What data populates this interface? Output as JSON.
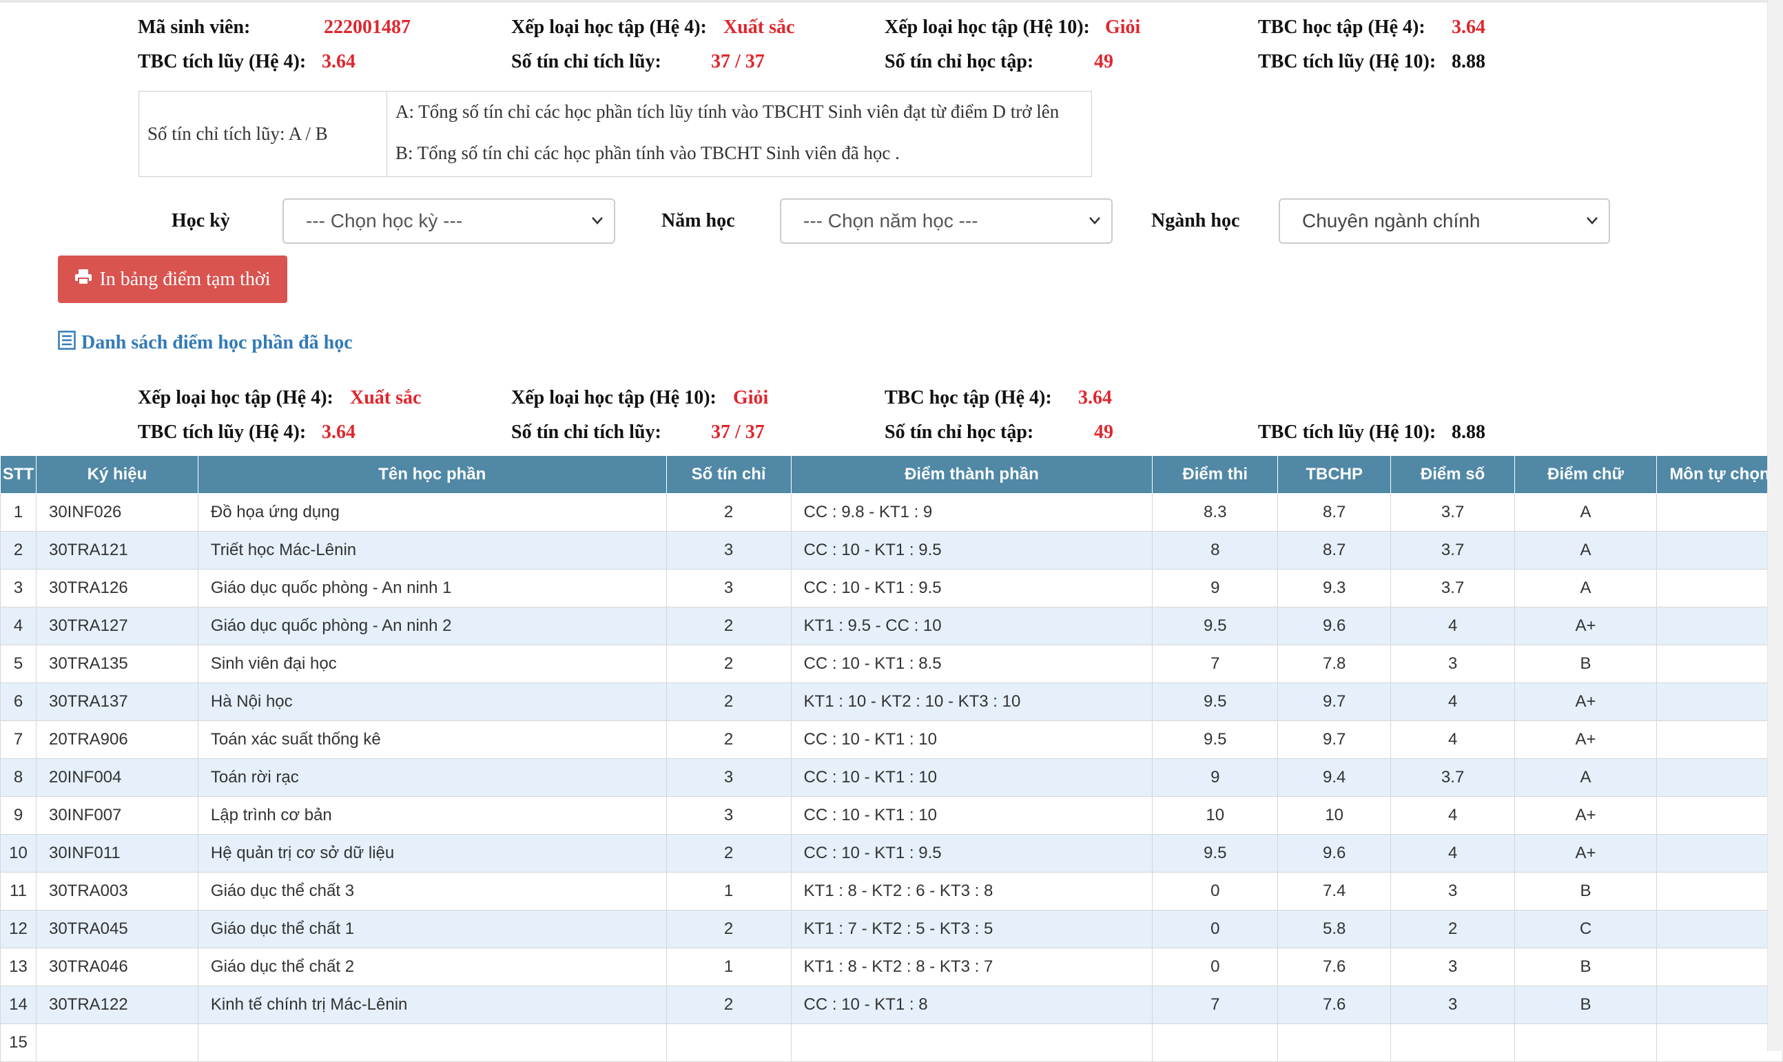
{
  "summary_top": {
    "row1": [
      {
        "label": "Mã sinh viên:",
        "value": "222001487",
        "color": "red"
      },
      {
        "label": "Xếp loại học tập (Hệ 4):",
        "value": "Xuất sắc",
        "color": "red"
      },
      {
        "label": "Xếp loại học tập (Hệ 10):",
        "value": "Giỏi",
        "color": "red"
      },
      {
        "label": "TBC học tập (Hệ 4):",
        "value": "3.64",
        "color": "red"
      }
    ],
    "row2": [
      {
        "label": "TBC tích lũy (Hệ 4):",
        "value": "3.64",
        "color": "red"
      },
      {
        "label": "Số tín chỉ tích lũy:",
        "value": "37 / 37",
        "color": "red"
      },
      {
        "label": "Số tín chỉ học tập:",
        "value": "49",
        "color": "red"
      },
      {
        "label": "TBC tích lũy (Hệ 10):",
        "value": "8.88",
        "color": "black"
      }
    ]
  },
  "legend": {
    "left": "Số tín chỉ tích lũy: A / B",
    "line_a": "A: Tổng số tín chỉ các học phần tích lũy tính vào TBCHT Sinh viên đạt từ điểm D trở lên",
    "line_b": "B: Tổng số tín chỉ các học phần tính vào TBCHT Sinh viên đã học ."
  },
  "filters": {
    "hoc_ky_label": "Học kỳ",
    "hoc_ky_value": "--- Chọn học kỳ ---",
    "nam_hoc_label": "Năm học",
    "nam_hoc_value": "--- Chọn năm học ---",
    "nganh_hoc_label": "Ngành học",
    "nganh_hoc_value": "Chuyên ngành chính"
  },
  "print_button": "In bảng điểm tạm thời",
  "section_title": "Danh sách điểm học phần đã học",
  "summary_bottom": {
    "row1": [
      {
        "label": "Xếp loại học tập (Hệ 4):",
        "value": "Xuất sắc",
        "color": "red"
      },
      {
        "label": "Xếp loại học tập (Hệ 10):",
        "value": "Giỏi",
        "color": "red"
      },
      {
        "label": "TBC học tập (Hệ 4):",
        "value": "3.64",
        "color": "red"
      }
    ],
    "row2": [
      {
        "label": "TBC tích lũy (Hệ 4):",
        "value": "3.64",
        "color": "red"
      },
      {
        "label": "Số tín chỉ tích lũy:",
        "value": "37 / 37",
        "color": "red"
      },
      {
        "label": "Số tín chỉ học tập:",
        "value": "49",
        "color": "red"
      },
      {
        "label": "TBC tích lũy (Hệ 10):",
        "value": "8.88",
        "color": "black"
      }
    ]
  },
  "table": {
    "headers": [
      "STT",
      "Ký hiệu",
      "Tên học phần",
      "Số tín chỉ",
      "Điểm thành phần",
      "Điểm thi",
      "TBCHP",
      "Điểm số",
      "Điểm chữ",
      "Môn tự chọn"
    ],
    "rows": [
      [
        "1",
        "30INF026",
        "Đồ họa ứng dụng",
        "2",
        "CC : 9.8 - KT1 : 9",
        "8.3",
        "8.7",
        "3.7",
        "A",
        ""
      ],
      [
        "2",
        "30TRA121",
        "Triết học Mác-Lênin",
        "3",
        "CC : 10 - KT1 : 9.5",
        "8",
        "8.7",
        "3.7",
        "A",
        ""
      ],
      [
        "3",
        "30TRA126",
        "Giáo dục quốc phòng - An ninh 1",
        "3",
        "CC : 10 - KT1 : 9.5",
        "9",
        "9.3",
        "3.7",
        "A",
        ""
      ],
      [
        "4",
        "30TRA127",
        "Giáo dục quốc phòng - An ninh 2",
        "2",
        "KT1 : 9.5 - CC : 10",
        "9.5",
        "9.6",
        "4",
        "A+",
        ""
      ],
      [
        "5",
        "30TRA135",
        "Sinh viên đại học",
        "2",
        "CC : 10 - KT1 : 8.5",
        "7",
        "7.8",
        "3",
        "B",
        ""
      ],
      [
        "6",
        "30TRA137",
        "Hà Nội học",
        "2",
        "KT1 : 10 - KT2 : 10 - KT3 : 10",
        "9.5",
        "9.7",
        "4",
        "A+",
        ""
      ],
      [
        "7",
        "20TRA906",
        "Toán xác suất thống kê",
        "2",
        "CC : 10 - KT1 : 10",
        "9.5",
        "9.7",
        "4",
        "A+",
        ""
      ],
      [
        "8",
        "20INF004",
        "Toán rời rạc",
        "3",
        "CC : 10 - KT1 : 10",
        "9",
        "9.4",
        "3.7",
        "A",
        ""
      ],
      [
        "9",
        "30INF007",
        "Lập trình cơ bản",
        "3",
        "CC : 10 - KT1 : 10",
        "10",
        "10",
        "4",
        "A+",
        ""
      ],
      [
        "10",
        "30INF011",
        "Hệ quản trị cơ sở dữ liệu",
        "2",
        "CC : 10 - KT1 : 9.5",
        "9.5",
        "9.6",
        "4",
        "A+",
        ""
      ],
      [
        "11",
        "30TRA003",
        "Giáo dục thể chất 3",
        "1",
        "KT1 : 8 - KT2 : 6 - KT3 : 8",
        "0",
        "7.4",
        "3",
        "B",
        ""
      ],
      [
        "12",
        "30TRA045",
        "Giáo dục thể chất 1",
        "2",
        "KT1 : 7 - KT2 : 5 - KT3 : 5",
        "0",
        "5.8",
        "2",
        "C",
        ""
      ],
      [
        "13",
        "30TRA046",
        "Giáo dục thể chất 2",
        "1",
        "KT1 : 8 - KT2 : 8 - KT3 : 7",
        "0",
        "7.6",
        "3",
        "B",
        ""
      ],
      [
        "14",
        "30TRA122",
        "Kinh tế chính trị Mác-Lênin",
        "2",
        "CC : 10 - KT1 : 8",
        "7",
        "7.6",
        "3",
        "B",
        ""
      ],
      [
        "15",
        "",
        "",
        "",
        "",
        "",
        "",
        "",
        "",
        ""
      ]
    ]
  },
  "colors": {
    "accent_red": "#e0262e",
    "header_blue": "#5088a6",
    "row_stripe": "#e5f0fa",
    "button_red": "#d9534f",
    "link_blue": "#337ab7"
  }
}
